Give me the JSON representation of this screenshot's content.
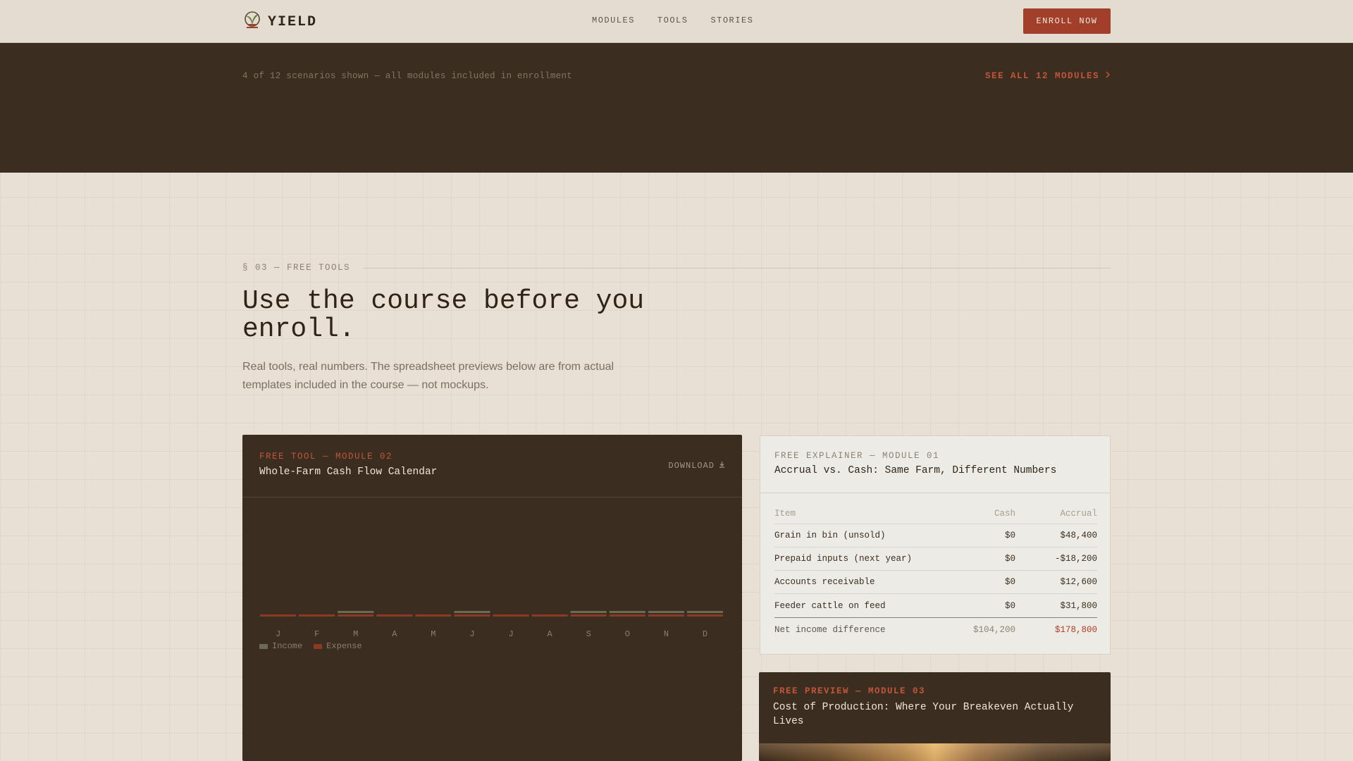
{
  "header": {
    "brand": "YIELD",
    "nav": [
      "MODULES",
      "TOOLS",
      "STORIES"
    ],
    "cta": "ENROLL NOW"
  },
  "band": {
    "note": "4 of 12 scenarios shown — all modules included in enrollment",
    "link": "SEE ALL 12 MODULES"
  },
  "section": {
    "eyebrow": "§ 03 — FREE TOOLS",
    "headline": "Use the course before you enroll.",
    "lede": "Real tools, real numbers. The spreadsheet previews below are from actual templates included in the course — not mockups."
  },
  "cashflow": {
    "tag": "FREE TOOL — MODULE 02",
    "title": "Whole-Farm Cash Flow Calendar",
    "download": "DOWNLOAD",
    "legend": [
      "Income",
      "Expense"
    ]
  },
  "chart_data": {
    "type": "bar",
    "categories": [
      "J",
      "F",
      "M",
      "A",
      "M",
      "J",
      "J",
      "A",
      "S",
      "O",
      "N",
      "D"
    ],
    "series": [
      {
        "name": "Income",
        "values": [
          0,
          0,
          1,
          0,
          0,
          1,
          0,
          0,
          1,
          1,
          1,
          1
        ]
      },
      {
        "name": "Expense",
        "values": [
          1,
          1,
          1,
          1,
          1,
          1,
          1,
          1,
          1,
          1,
          1,
          1
        ]
      }
    ],
    "colors": {
      "Income": "#6b6a55",
      "Expense": "#8c3a24"
    }
  },
  "accrual": {
    "tag": "FREE EXPLAINER — MODULE 01",
    "title": "Accrual vs. Cash: Same Farm, Different Numbers",
    "columns": [
      "Item",
      "Cash",
      "Accrual"
    ],
    "rows": [
      {
        "item": "Grain in bin (unsold)",
        "cash": "$0",
        "accrual": "$48,400"
      },
      {
        "item": "Prepaid inputs (next year)",
        "cash": "$0",
        "accrual": "-$18,200"
      },
      {
        "item": "Accounts receivable",
        "cash": "$0",
        "accrual": "$12,600"
      },
      {
        "item": "Feeder cattle on feed",
        "cash": "$0",
        "accrual": "$31,800"
      }
    ],
    "total": {
      "item": "Net income difference",
      "cash": "$104,200",
      "accrual": "$178,800"
    }
  },
  "preview": {
    "tag": "FREE PREVIEW — MODULE 03",
    "title": "Cost of Production: Where Your Breakeven Actually Lives"
  },
  "colors": {
    "accent": "#a13f2a",
    "dark": "#3b2e20",
    "paper": "#e8e0d5"
  }
}
